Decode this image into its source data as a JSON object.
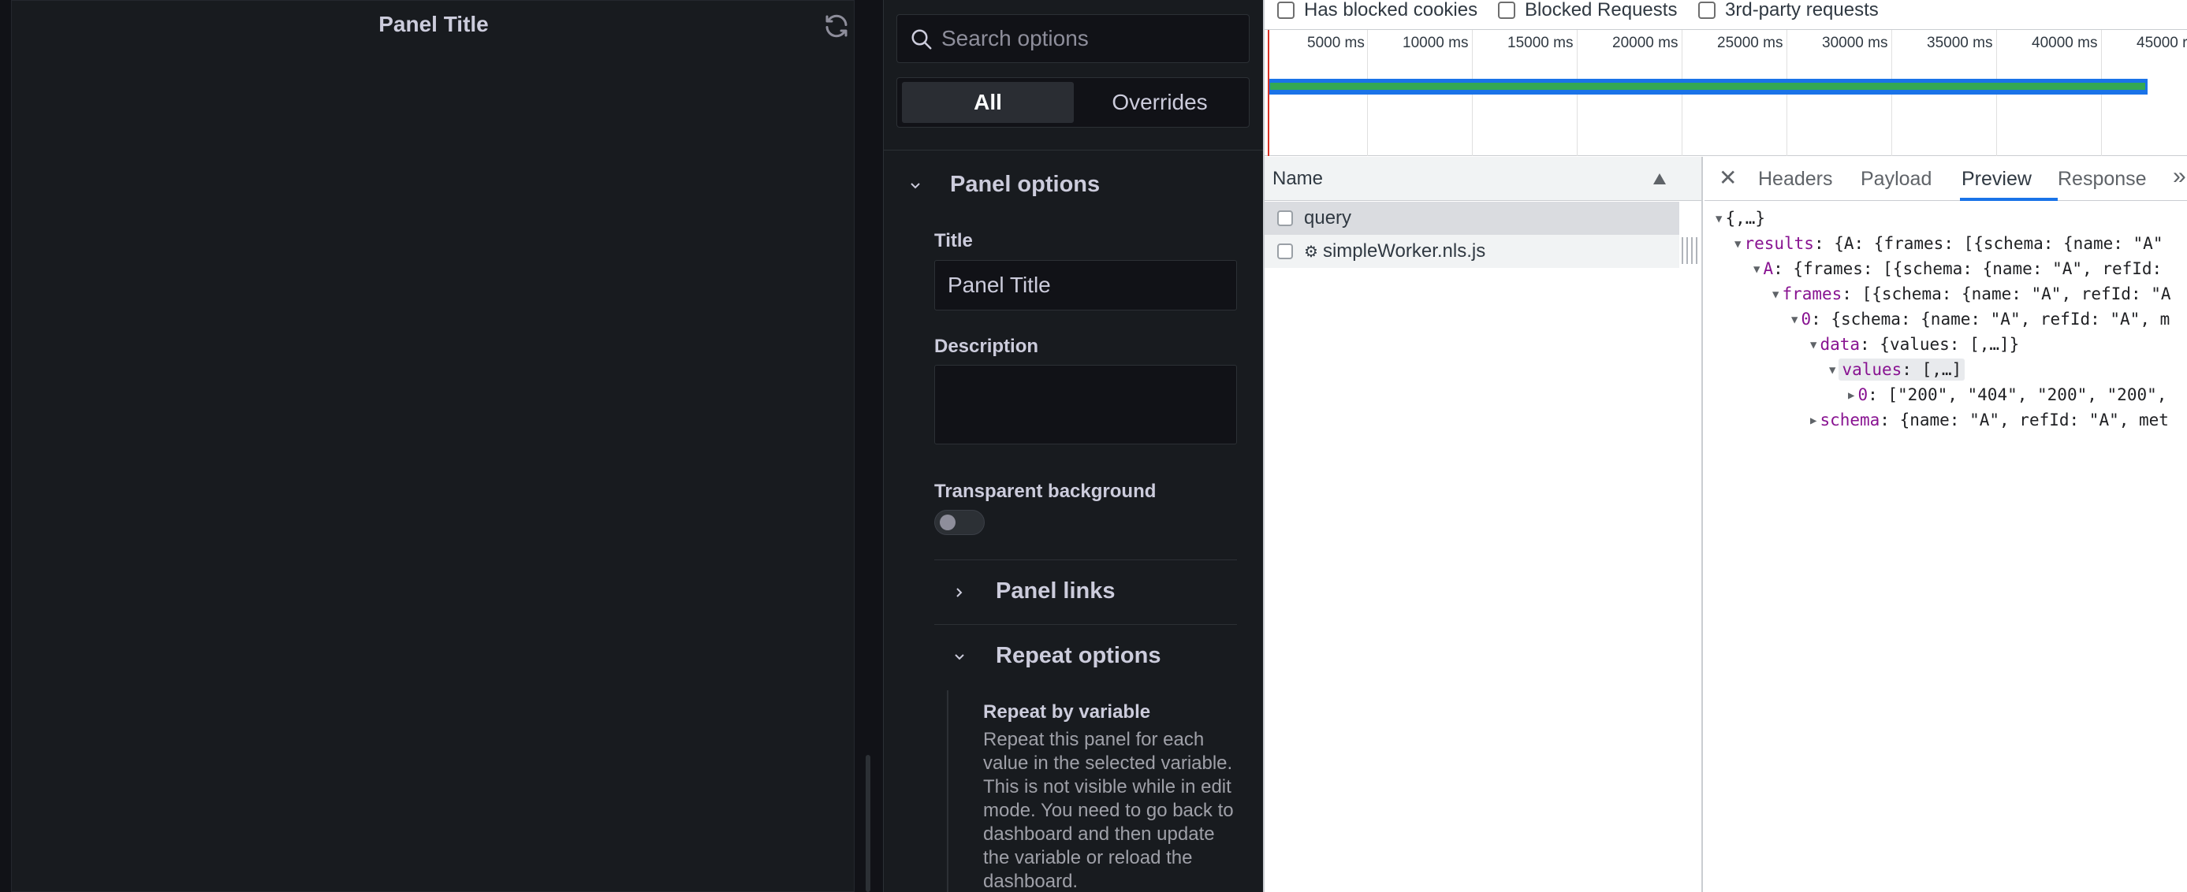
{
  "panel": {
    "title": "Panel Title",
    "refresh_icon": "refresh-icon"
  },
  "options": {
    "search_placeholder": "Search options",
    "tabs": {
      "all": "All",
      "overrides": "Overrides"
    },
    "panel_options_header": "Panel options",
    "title_label": "Title",
    "title_value": "Panel Title",
    "description_label": "Description",
    "description_value": "",
    "transparent_label": "Transparent background",
    "transparent_on": false,
    "panel_links_header": "Panel links",
    "repeat_header": "Repeat options",
    "repeat_by_label": "Repeat by variable",
    "repeat_desc": "Repeat this panel for each value in the selected variable. This is not visible while in edit mode. You need to go back to dashboard and then update the variable or reload the dashboard."
  },
  "devtools": {
    "filters": [
      "Has blocked cookies",
      "Blocked Requests",
      "3rd-party requests"
    ],
    "timeline_ticks": [
      "5000 ms",
      "10000 ms",
      "15000 ms",
      "20000 ms",
      "25000 ms",
      "30000 ms",
      "35000 ms",
      "40000 ms",
      "45000 r"
    ],
    "list_header": "Name",
    "requests": [
      "query",
      "simpleWorker.nls.js"
    ],
    "detail_tabs": [
      "Headers",
      "Payload",
      "Preview",
      "Response"
    ],
    "active_tab": "Preview",
    "json_lines": {
      "l0": "{,…}",
      "l1_key": "results",
      "l1_val": ": {A: {frames: [{schema: {name: \"A\"",
      "l2_key": "A",
      "l2_val": ": {frames: [{schema: {name: \"A\", refId:",
      "l3_key": "frames",
      "l3_val": ": [{schema: {name: \"A\", refId: \"A",
      "l4_key": "0",
      "l4_val": ": {schema: {name: \"A\", refId: \"A\", m",
      "l5_key": "data",
      "l5_val": ": {values: [,…]}",
      "l6_key": "values",
      "l6_val": ": [,…]",
      "l7_key": "0",
      "l7_val": ": [\"200\", \"404\", \"200\", \"200\",",
      "l8_key": "schema",
      "l8_val": ": {name: \"A\", refId: \"A\", met"
    }
  }
}
